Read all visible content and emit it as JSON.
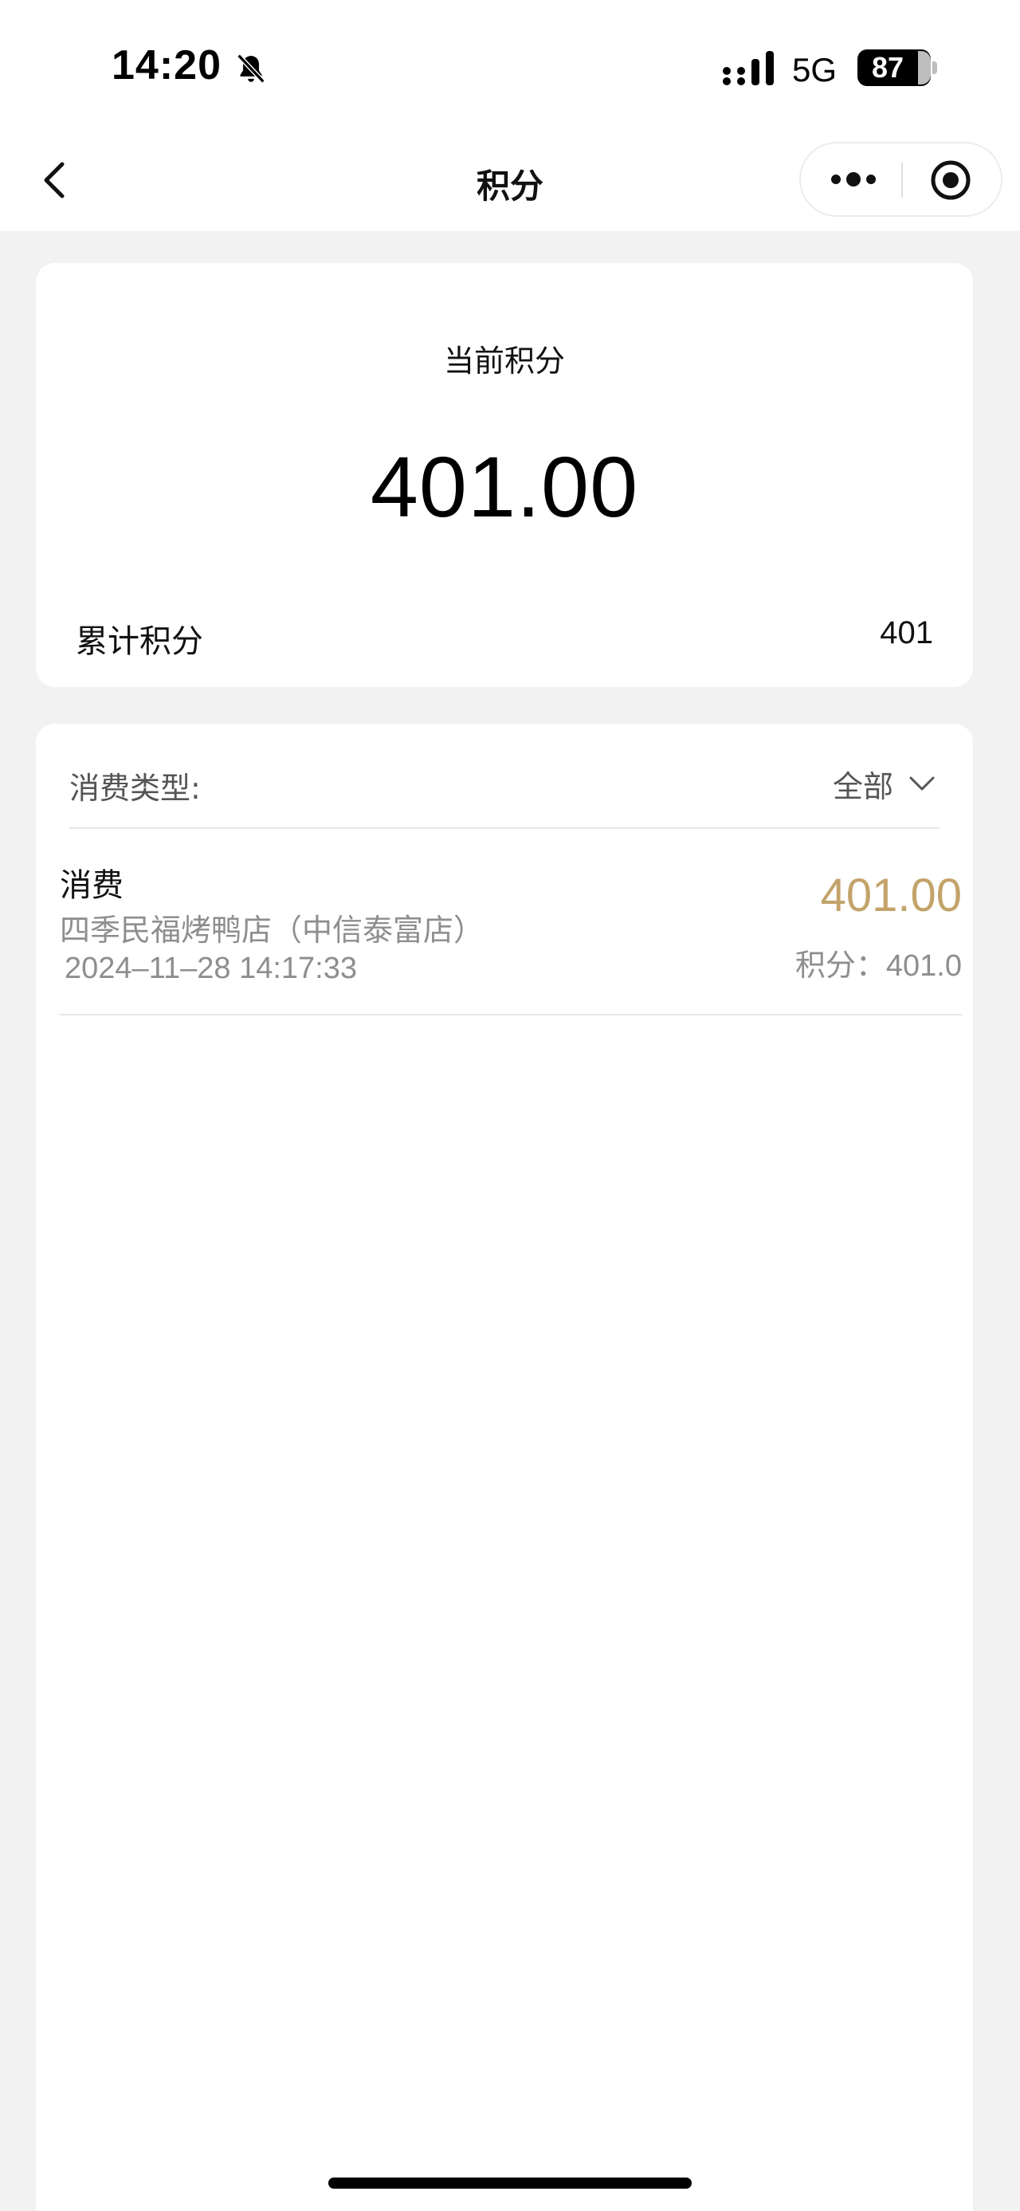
{
  "status_bar": {
    "time": "14:20",
    "network": "5G",
    "battery": "87",
    "icons": [
      "bell-off-icon",
      "signal-icon",
      "battery-icon"
    ]
  },
  "nav": {
    "title": "积分",
    "icons": [
      "chevron-left-icon",
      "more-dots-icon",
      "target-icon"
    ]
  },
  "points_card": {
    "current_label": "当前积分",
    "current_value": "401.00",
    "total_label": "累计积分",
    "total_value": "401"
  },
  "records": {
    "filter_label": "消费类型:",
    "filter_value": "全部",
    "items": [
      {
        "type": "消费",
        "store": "四季民福烤鸭店（中信泰富店）",
        "time": "2024–11–28 14:17:33",
        "amount": "401.00",
        "points": "积分：401.0"
      }
    ]
  },
  "colors": {
    "amount_gold": "#c3a36a",
    "secondary_text": "#8e8e8e",
    "page_background": "#f2f2f2"
  }
}
